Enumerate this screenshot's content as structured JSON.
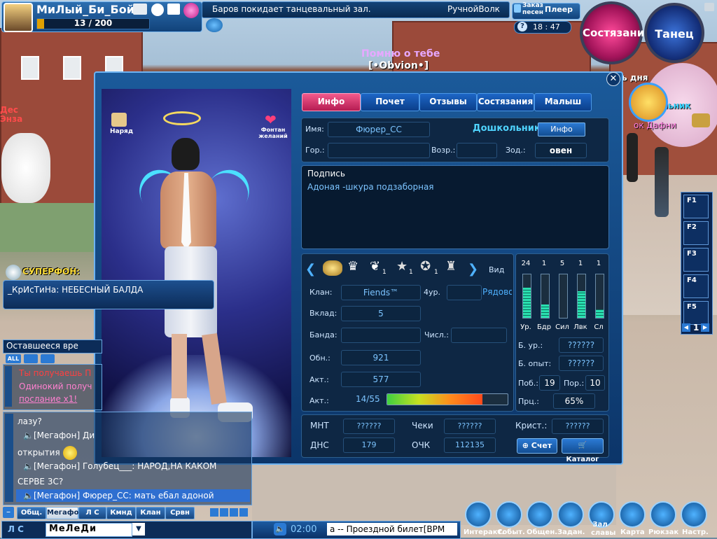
{
  "player": {
    "name": "МиЛый_Би_Бой",
    "progress": "13 / 200"
  },
  "marquee": {
    "text": "Баров покидает танцевальный зал.",
    "author": "РучнойВолк"
  },
  "top_buttons": {
    "order_songs": "Заказ песен",
    "player": "Плеер",
    "time": "18 : 47"
  },
  "big_buttons": {
    "competition": "Состязание",
    "dance": "Танец"
  },
  "world_text": {
    "song": "Помню о тебе",
    "nick": "[•Obvion•]",
    "left1": "Дес",
    "left2": "Энза",
    "right_nick": "ольник",
    "right2": "ок Дафни",
    "day": "ь дня"
  },
  "profile": {
    "tabs": [
      "Инфо",
      "Почет",
      "Отзывы",
      "Состязания",
      "Малыш"
    ],
    "active_tab": 0,
    "icons": {
      "outfit": "Наряд",
      "fountain": "Фонтан желаний"
    },
    "name_label": "Имя:",
    "name_value": "Фюрер_СС",
    "rank": "Дошкольник",
    "rank_btn": "Инфо",
    "city_label": "Гор.:",
    "city_value": "",
    "age_label": "Возр.:",
    "age_value": "",
    "zodiac_label": "Зод.:",
    "zodiac_value": "овен",
    "signature_label": "Подпись",
    "signature_text": "Адоная -шкура подзаборная",
    "view_label": "Вид",
    "badge_counts": [
      "1",
      "1",
      "1"
    ],
    "clan_label": "Клан:",
    "clan_value": "Fiends™",
    "clan_level": "4ур.",
    "clan_role": "Рядовой",
    "deposit_label": "Вклад:",
    "deposit_value": "5",
    "gang_label": "Банда:",
    "gang_value": "",
    "count_label": "Числ.:",
    "count_value": "",
    "exchange_label": "Обн.:",
    "exchange_value": "921",
    "act_label": "Акт.:",
    "act_value": "577",
    "act2_label": "Акт.:",
    "act2_value": "14/55",
    "act2_progress": 0.79,
    "stats": {
      "labels": [
        "Ур.",
        "Бдр",
        "Сил",
        "Лвк",
        "Сл"
      ],
      "values": [
        "24",
        "1",
        "5",
        "1",
        "1"
      ],
      "fill": [
        0.7,
        0.3,
        0.0,
        0.62,
        0.2
      ]
    },
    "b_level_label": "Б. ур.:",
    "b_level_value": "??????",
    "b_exp_label": "Б. опыт:",
    "b_exp_value": "??????",
    "wins_label": "Поб.:",
    "wins_value": "19",
    "losses_label": "Пор.:",
    "losses_value": "10",
    "pct_label": "Прц.:",
    "pct_value": "65%",
    "mnt_label": "МНТ",
    "mnt_value": "??????",
    "checks_label": "Чеки",
    "checks_value": "??????",
    "crystals_label": "Крист.:",
    "crystals_value": "??????",
    "dns_label": "ДНС",
    "dns_value": "179",
    "points_label": "ОЧК",
    "points_value": "112135",
    "score_btn": "Счет",
    "catalog_btn": "Каталог"
  },
  "superphone": {
    "label": "СУПЕРФОН:",
    "message": "_КрИсТиНа: НЕБЕСНЫЙ БАЛДА"
  },
  "remaining": {
    "title": "Оставшееся вре",
    "lines": [
      "Ты получаешь П",
      "Одинокий получ",
      "послание x1!"
    ],
    "tabs": [
      "ALL"
    ]
  },
  "chat": {
    "lines": [
      "лазу?",
      "[Мегафон] Ди",
      "открытия",
      "[Мегафон] Голубец___: НАРОД,НА КАКОМ",
      "СЕРВЕ 3С?",
      "[Мегафон] Фюрер_СС: мать ебал адоной"
    ],
    "tabs": [
      "Общ.",
      "Мегафон",
      "Л С",
      "Кмнд",
      "Клан",
      "Срвн"
    ],
    "active_tab": 1,
    "input_mode": "Л С",
    "input_value": "МеЛеДи"
  },
  "bottom_bar": {
    "time": "02:00",
    "ticker": "а -- Проездной билет[BPM"
  },
  "fkeys": [
    "F1",
    "F2",
    "F3",
    "F4",
    "F5"
  ],
  "fkey_page": "1",
  "menu": [
    "Интеракт.",
    "Событ.",
    "Общен.",
    "Задан.",
    "Зал славы",
    "Карта",
    "Рюкзак",
    "Настр."
  ]
}
